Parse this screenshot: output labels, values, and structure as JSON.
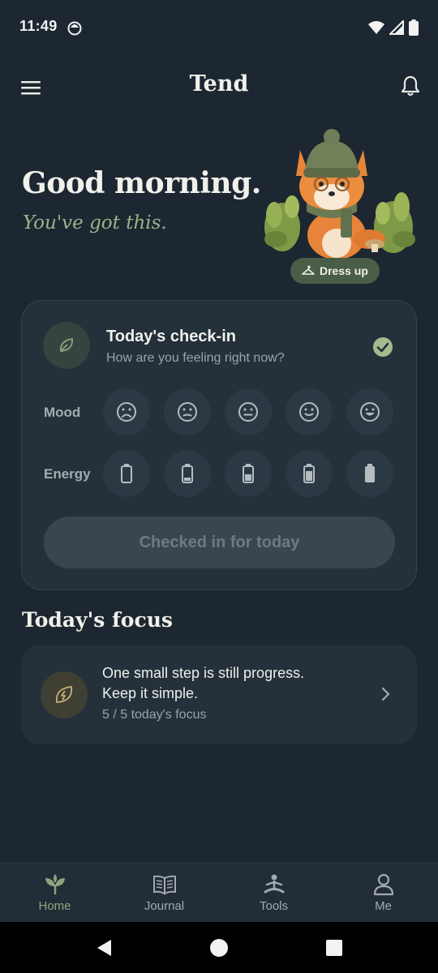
{
  "status_bar": {
    "time": "11:49"
  },
  "app_bar": {
    "title": "Tend"
  },
  "greeting": {
    "title": "Good morning.",
    "subtitle": "You've got this."
  },
  "mascot": {
    "dress_up_label": "Dress up"
  },
  "checkin": {
    "title": "Today's check-in",
    "subtitle": "How are you feeling right now?",
    "mood_label": "Mood",
    "energy_label": "Energy",
    "button_label": "Checked in for today",
    "completed": true,
    "mood_options": [
      "very-sad-face-icon",
      "slightly-sad-face-icon",
      "neutral-face-icon",
      "slightly-smiling-face-icon",
      "happy-face-icon"
    ],
    "energy_levels": [
      0,
      0.25,
      0.5,
      0.75,
      1
    ]
  },
  "focus": {
    "heading": "Today's focus",
    "line1": "One small step is still progress.",
    "line2": "Keep it simple.",
    "progress": "5 / 5 today's focus"
  },
  "bottom_nav": {
    "items": [
      {
        "label": "Home",
        "icon": "sprout-icon",
        "active": true
      },
      {
        "label": "Journal",
        "icon": "book-icon",
        "active": false
      },
      {
        "label": "Tools",
        "icon": "meditation-icon",
        "active": false
      },
      {
        "label": "Me",
        "icon": "person-icon",
        "active": false
      }
    ]
  },
  "colors": {
    "background": "#1c2731",
    "card": "#24303a",
    "accent_green": "#9db28a",
    "check_green": "#a7b98e"
  }
}
